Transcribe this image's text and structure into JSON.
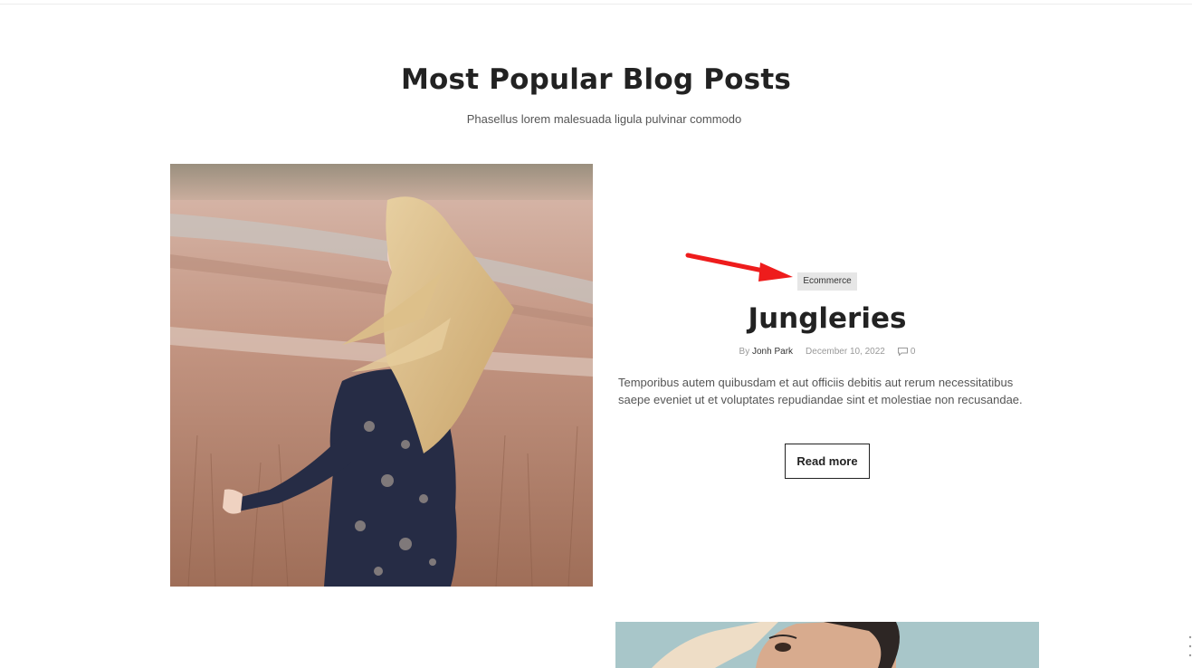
{
  "section": {
    "title": "Most Popular Blog Posts",
    "subtitle": "Phasellus lorem malesuada ligula pulvinar commodo"
  },
  "post": {
    "category": "Ecommerce",
    "title": "Jungleries",
    "by_label": "By",
    "author": "Jonh Park",
    "date": "December 10, 2022",
    "comments_count": "0",
    "excerpt": "Temporibus autem quibusdam et aut officiis debitis aut rerum  necessitatibus saepe eveniet ut et voluptates repudiandae sint et molestiae non recusandae.",
    "read_more_label": "Read more"
  },
  "icons": {
    "comment": "comment-icon",
    "arrow": "arrow-annotation"
  },
  "colors": {
    "annotation_arrow": "#ee1c1c",
    "badge_bg": "#e6e6e6",
    "text_dark": "#222222"
  }
}
